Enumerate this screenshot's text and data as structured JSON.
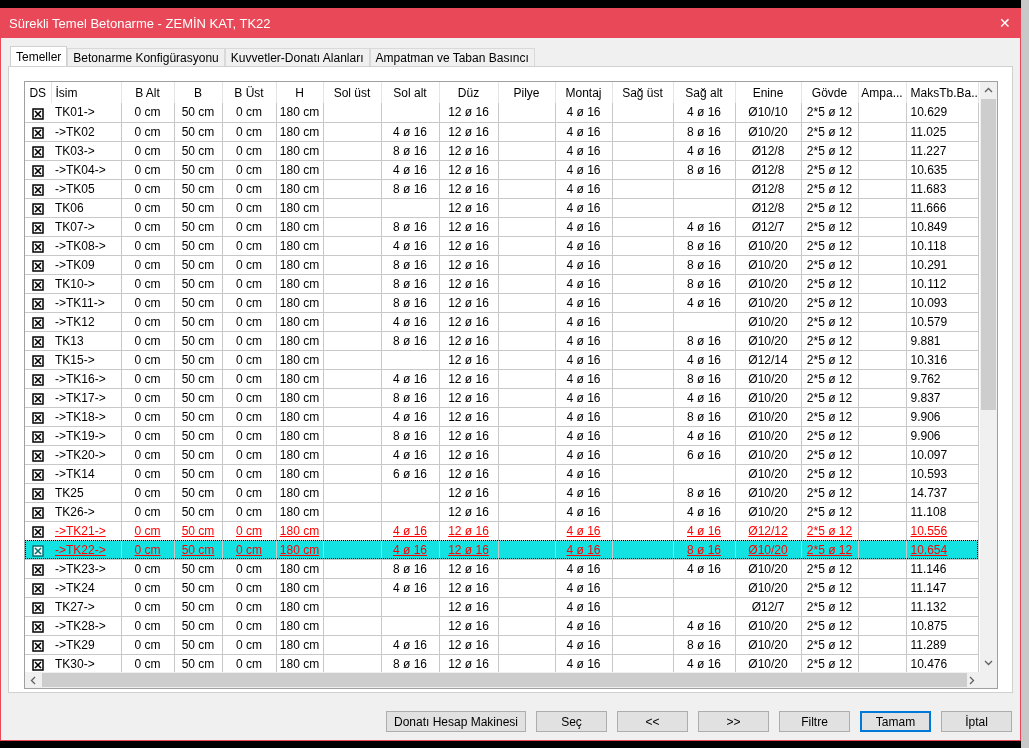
{
  "window": {
    "title": "Sürekli Temel Betonarme - ZEMİN KAT, TK22",
    "close": "✕"
  },
  "tabs": [
    {
      "label": "Temeller",
      "selected": true
    },
    {
      "label": "Betonarme Konfigürasyonu",
      "selected": false
    },
    {
      "label": "Kuvvetler-Donatı Alanları",
      "selected": false
    },
    {
      "label": "Ampatman ve Taban Basıncı",
      "selected": false
    }
  ],
  "table": {
    "checkbox_column": "DS",
    "columns": [
      "İsim",
      "B Alt",
      "B",
      "B Üst",
      "H",
      "Sol üst",
      "Sol alt",
      "Düz",
      "Pilye",
      "Montaj",
      "Sağ üst",
      "Sağ alt",
      "Enine",
      "Gövde",
      "Ampa...",
      "MaksTb.Ba.."
    ],
    "rows": [
      {
        "checked": true,
        "selected": false,
        "flagged": false,
        "cells": [
          "TK01->",
          "0 cm",
          "50 cm",
          "0 cm",
          "180 cm",
          null,
          null,
          "12 ø 16",
          null,
          "4 ø 16",
          null,
          "4 ø 16",
          "Ø10/10",
          "2*5 ø 12",
          null,
          "10.629"
        ]
      },
      {
        "checked": true,
        "selected": false,
        "flagged": false,
        "cells": [
          "->TK02",
          "0 cm",
          "50 cm",
          "0 cm",
          "180 cm",
          null,
          "4 ø 16",
          "12 ø 16",
          null,
          "4 ø 16",
          null,
          "8 ø 16",
          "Ø10/20",
          "2*5 ø 12",
          null,
          "11.025"
        ]
      },
      {
        "checked": true,
        "selected": false,
        "flagged": false,
        "cells": [
          "TK03->",
          "0 cm",
          "50 cm",
          "0 cm",
          "180 cm",
          null,
          "8 ø 16",
          "12 ø 16",
          null,
          "4 ø 16",
          null,
          "4 ø 16",
          "Ø12/8",
          "2*5 ø 12",
          null,
          "11.227"
        ]
      },
      {
        "checked": true,
        "selected": false,
        "flagged": false,
        "cells": [
          "->TK04->",
          "0 cm",
          "50 cm",
          "0 cm",
          "180 cm",
          null,
          "4 ø 16",
          "12 ø 16",
          null,
          "4 ø 16",
          null,
          "8 ø 16",
          "Ø12/8",
          "2*5 ø 12",
          null,
          "10.635"
        ]
      },
      {
        "checked": true,
        "selected": false,
        "flagged": false,
        "cells": [
          "->TK05",
          "0 cm",
          "50 cm",
          "0 cm",
          "180 cm",
          null,
          "8 ø 16",
          "12 ø 16",
          null,
          "4 ø 16",
          null,
          null,
          "Ø12/8",
          "2*5 ø 12",
          null,
          "11.683"
        ]
      },
      {
        "checked": true,
        "selected": false,
        "flagged": false,
        "cells": [
          "TK06",
          "0 cm",
          "50 cm",
          "0 cm",
          "180 cm",
          null,
          null,
          "12 ø 16",
          null,
          "4 ø 16",
          null,
          null,
          "Ø12/8",
          "2*5 ø 12",
          null,
          "11.666"
        ]
      },
      {
        "checked": true,
        "selected": false,
        "flagged": false,
        "cells": [
          "TK07->",
          "0 cm",
          "50 cm",
          "0 cm",
          "180 cm",
          null,
          "8 ø 16",
          "12 ø 16",
          null,
          "4 ø 16",
          null,
          "4 ø 16",
          "Ø12/7",
          "2*5 ø 12",
          null,
          "10.849"
        ]
      },
      {
        "checked": true,
        "selected": false,
        "flagged": false,
        "cells": [
          "->TK08->",
          "0 cm",
          "50 cm",
          "0 cm",
          "180 cm",
          null,
          "4 ø 16",
          "12 ø 16",
          null,
          "4 ø 16",
          null,
          "8 ø 16",
          "Ø10/20",
          "2*5 ø 12",
          null,
          "10.118"
        ]
      },
      {
        "checked": true,
        "selected": false,
        "flagged": false,
        "cells": [
          "->TK09",
          "0 cm",
          "50 cm",
          "0 cm",
          "180 cm",
          null,
          "8 ø 16",
          "12 ø 16",
          null,
          "4 ø 16",
          null,
          "8 ø 16",
          "Ø10/20",
          "2*5 ø 12",
          null,
          "10.291"
        ]
      },
      {
        "checked": true,
        "selected": false,
        "flagged": false,
        "cells": [
          "TK10->",
          "0 cm",
          "50 cm",
          "0 cm",
          "180 cm",
          null,
          "8 ø 16",
          "12 ø 16",
          null,
          "4 ø 16",
          null,
          "8 ø 16",
          "Ø10/20",
          "2*5 ø 12",
          null,
          "10.112"
        ]
      },
      {
        "checked": true,
        "selected": false,
        "flagged": false,
        "cells": [
          "->TK11->",
          "0 cm",
          "50 cm",
          "0 cm",
          "180 cm",
          null,
          "8 ø 16",
          "12 ø 16",
          null,
          "4 ø 16",
          null,
          "4 ø 16",
          "Ø10/20",
          "2*5 ø 12",
          null,
          "10.093"
        ]
      },
      {
        "checked": true,
        "selected": false,
        "flagged": false,
        "cells": [
          "->TK12",
          "0 cm",
          "50 cm",
          "0 cm",
          "180 cm",
          null,
          "4 ø 16",
          "12 ø 16",
          null,
          "4 ø 16",
          null,
          null,
          "Ø10/20",
          "2*5 ø 12",
          null,
          "10.579"
        ]
      },
      {
        "checked": true,
        "selected": false,
        "flagged": false,
        "cells": [
          "TK13",
          "0 cm",
          "50 cm",
          "0 cm",
          "180 cm",
          null,
          "8 ø 16",
          "12 ø 16",
          null,
          "4 ø 16",
          null,
          "8 ø 16",
          "Ø10/20",
          "2*5 ø 12",
          null,
          "9.881"
        ]
      },
      {
        "checked": true,
        "selected": false,
        "flagged": false,
        "cells": [
          "TK15->",
          "0 cm",
          "50 cm",
          "0 cm",
          "180 cm",
          null,
          null,
          "12 ø 16",
          null,
          "4 ø 16",
          null,
          "4 ø 16",
          "Ø12/14",
          "2*5 ø 12",
          null,
          "10.316"
        ]
      },
      {
        "checked": true,
        "selected": false,
        "flagged": false,
        "cells": [
          "->TK16->",
          "0 cm",
          "50 cm",
          "0 cm",
          "180 cm",
          null,
          "4 ø 16",
          "12 ø 16",
          null,
          "4 ø 16",
          null,
          "8 ø 16",
          "Ø10/20",
          "2*5 ø 12",
          null,
          "9.762"
        ]
      },
      {
        "checked": true,
        "selected": false,
        "flagged": false,
        "cells": [
          "->TK17->",
          "0 cm",
          "50 cm",
          "0 cm",
          "180 cm",
          null,
          "8 ø 16",
          "12 ø 16",
          null,
          "4 ø 16",
          null,
          "4 ø 16",
          "Ø10/20",
          "2*5 ø 12",
          null,
          "9.837"
        ]
      },
      {
        "checked": true,
        "selected": false,
        "flagged": false,
        "cells": [
          "->TK18->",
          "0 cm",
          "50 cm",
          "0 cm",
          "180 cm",
          null,
          "4 ø 16",
          "12 ø 16",
          null,
          "4 ø 16",
          null,
          "8 ø 16",
          "Ø10/20",
          "2*5 ø 12",
          null,
          "9.906"
        ]
      },
      {
        "checked": true,
        "selected": false,
        "flagged": false,
        "cells": [
          "->TK19->",
          "0 cm",
          "50 cm",
          "0 cm",
          "180 cm",
          null,
          "8 ø 16",
          "12 ø 16",
          null,
          "4 ø 16",
          null,
          "4 ø 16",
          "Ø10/20",
          "2*5 ø 12",
          null,
          "9.906"
        ]
      },
      {
        "checked": true,
        "selected": false,
        "flagged": false,
        "cells": [
          "->TK20->",
          "0 cm",
          "50 cm",
          "0 cm",
          "180 cm",
          null,
          "4 ø 16",
          "12 ø 16",
          null,
          "4 ø 16",
          null,
          "6 ø 16",
          "Ø10/20",
          "2*5 ø 12",
          null,
          "10.097"
        ]
      },
      {
        "checked": true,
        "selected": false,
        "flagged": false,
        "cells": [
          "->TK14",
          "0 cm",
          "50 cm",
          "0 cm",
          "180 cm",
          null,
          "6 ø 16",
          "12 ø 16",
          null,
          "4 ø 16",
          null,
          null,
          "Ø10/20",
          "2*5 ø 12",
          null,
          "10.593"
        ]
      },
      {
        "checked": true,
        "selected": false,
        "flagged": false,
        "cells": [
          "TK25",
          "0 cm",
          "50 cm",
          "0 cm",
          "180 cm",
          null,
          null,
          "12 ø 16",
          null,
          "4 ø 16",
          null,
          "8 ø 16",
          "Ø10/20",
          "2*5 ø 12",
          null,
          "14.737"
        ]
      },
      {
        "checked": true,
        "selected": false,
        "flagged": false,
        "cells": [
          "TK26->",
          "0 cm",
          "50 cm",
          "0 cm",
          "180 cm",
          null,
          null,
          "12 ø 16",
          null,
          "4 ø 16",
          null,
          "4 ø 16",
          "Ø10/20",
          "2*5 ø 12",
          null,
          "11.108"
        ]
      },
      {
        "checked": true,
        "selected": false,
        "flagged": true,
        "cells": [
          "->TK21->",
          "0 cm",
          "50 cm",
          "0 cm",
          "180 cm",
          null,
          "4 ø 16",
          "12 ø 16",
          null,
          "4 ø 16",
          null,
          "4 ø 16",
          "Ø12/12",
          "2*5 ø 12",
          null,
          "10.556"
        ]
      },
      {
        "checked": true,
        "selected": true,
        "flagged": true,
        "cells": [
          "->TK22->",
          "0 cm",
          "50 cm",
          "0 cm",
          "180 cm",
          null,
          "4 ø 16",
          "12 ø 16",
          null,
          "4 ø 16",
          null,
          "8 ø 16",
          "Ø10/20",
          "2*5 ø 12",
          null,
          "10.654"
        ]
      },
      {
        "checked": true,
        "selected": false,
        "flagged": false,
        "cells": [
          "->TK23->",
          "0 cm",
          "50 cm",
          "0 cm",
          "180 cm",
          null,
          "8 ø 16",
          "12 ø 16",
          null,
          "4 ø 16",
          null,
          "4 ø 16",
          "Ø10/20",
          "2*5 ø 12",
          null,
          "11.146"
        ]
      },
      {
        "checked": true,
        "selected": false,
        "flagged": false,
        "cells": [
          "->TK24",
          "0 cm",
          "50 cm",
          "0 cm",
          "180 cm",
          null,
          "4 ø 16",
          "12 ø 16",
          null,
          "4 ø 16",
          null,
          null,
          "Ø10/20",
          "2*5 ø 12",
          null,
          "11.147"
        ]
      },
      {
        "checked": true,
        "selected": false,
        "flagged": false,
        "cells": [
          "TK27->",
          "0 cm",
          "50 cm",
          "0 cm",
          "180 cm",
          null,
          null,
          "12 ø 16",
          null,
          "4 ø 16",
          null,
          null,
          "Ø12/7",
          "2*5 ø 12",
          null,
          "11.132"
        ]
      },
      {
        "checked": true,
        "selected": false,
        "flagged": false,
        "cells": [
          "->TK28->",
          "0 cm",
          "50 cm",
          "0 cm",
          "180 cm",
          null,
          null,
          "12 ø 16",
          null,
          "4 ø 16",
          null,
          "4 ø 16",
          "Ø10/20",
          "2*5 ø 12",
          null,
          "10.875"
        ]
      },
      {
        "checked": true,
        "selected": false,
        "flagged": false,
        "cells": [
          "->TK29",
          "0 cm",
          "50 cm",
          "0 cm",
          "180 cm",
          null,
          "4 ø 16",
          "12 ø 16",
          null,
          "4 ø 16",
          null,
          "8 ø 16",
          "Ø10/20",
          "2*5 ø 12",
          null,
          "11.289"
        ]
      },
      {
        "checked": true,
        "selected": false,
        "flagged": false,
        "cells": [
          "TK30->",
          "0 cm",
          "50 cm",
          "0 cm",
          "180 cm",
          null,
          "8 ø 16",
          "12 ø 16",
          null,
          "4 ø 16",
          null,
          "4 ø 16",
          "Ø10/20",
          "2*5 ø 12",
          null,
          "10.476"
        ]
      }
    ]
  },
  "buttons": [
    {
      "label": "Donatı Hesap Makinesi",
      "default": false
    },
    {
      "label": "Seç",
      "default": false
    },
    {
      "label": "<<",
      "default": false
    },
    {
      "label": ">>",
      "default": false
    },
    {
      "label": "Filtre",
      "default": false
    },
    {
      "label": "Tamam",
      "default": true
    },
    {
      "label": "İptal",
      "default": false
    }
  ]
}
